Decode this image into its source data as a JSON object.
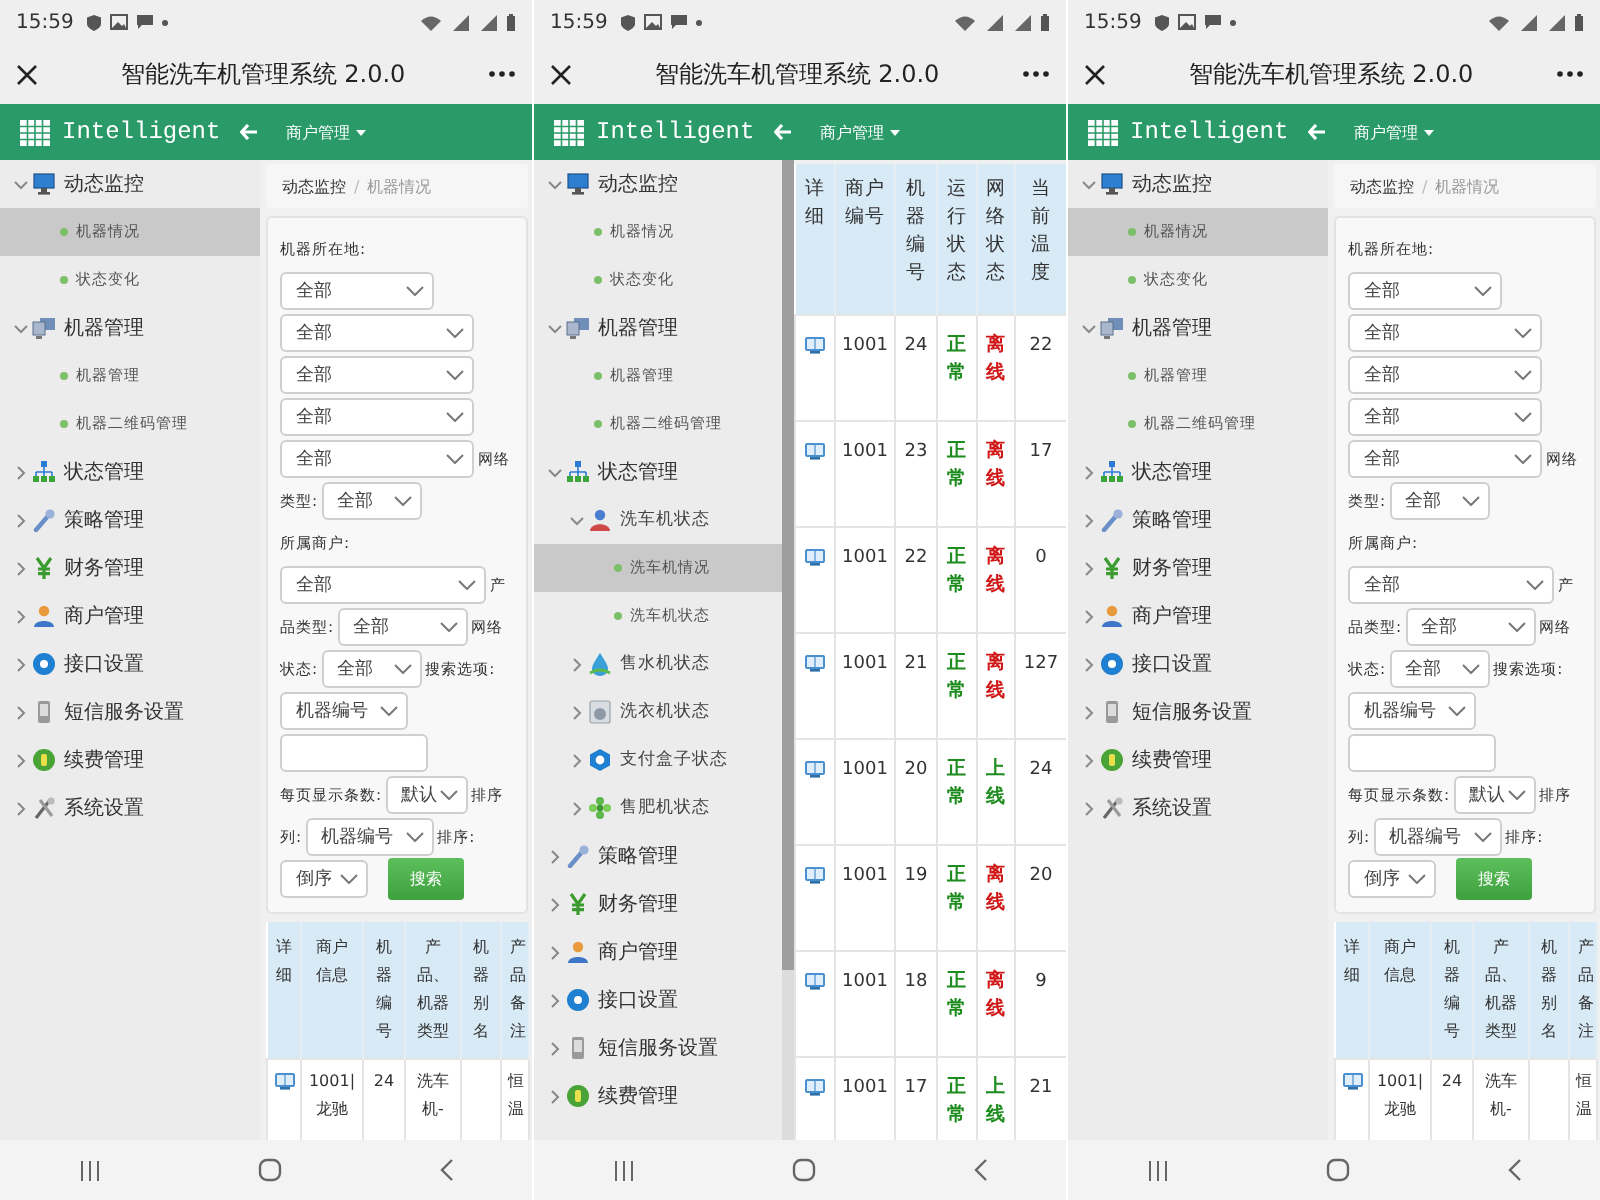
{
  "screens": [
    {
      "status_bar": {
        "time": "15:59"
      },
      "title_bar": {
        "title": "智能洗车机管理系统 2.0.0"
      },
      "header": {
        "brand": "Intelligent",
        "menu": "商户管理"
      },
      "sidebar": {
        "items": [
          {
            "label": "动态监控",
            "expanded": true,
            "selected": false,
            "children": [
              {
                "label": "机器情况",
                "selected": true
              },
              {
                "label": "状态变化",
                "selected": false
              }
            ]
          },
          {
            "label": "机器管理",
            "expanded": true,
            "selected": false,
            "children": [
              {
                "label": "机器管理",
                "selected": false
              },
              {
                "label": "机器二维码管理",
                "selected": false
              }
            ]
          },
          {
            "label": "状态管理",
            "expanded": false,
            "selected": false
          },
          {
            "label": "策略管理",
            "expanded": false,
            "selected": false
          },
          {
            "label": "财务管理",
            "expanded": false,
            "selected": false
          },
          {
            "label": "商户管理",
            "expanded": false,
            "selected": false
          },
          {
            "label": "接口设置",
            "expanded": false,
            "selected": false
          },
          {
            "label": "短信服务设置",
            "expanded": false,
            "selected": false
          },
          {
            "label": "续费管理",
            "expanded": false,
            "selected": false
          },
          {
            "label": "系统设置",
            "expanded": false,
            "selected": false
          }
        ]
      },
      "content": {
        "kind": "form",
        "breadcrumb": {
          "items": [
            "动态监控",
            "机器情况"
          ],
          "separator": "/"
        },
        "form": {
          "lines": [
            [
              {
                "kind": "label",
                "text": "机器所在地:"
              }
            ],
            [
              {
                "kind": "select",
                "value": "全部"
              }
            ],
            [
              {
                "kind": "select",
                "value": "全部"
              }
            ],
            [
              {
                "kind": "select",
                "value": "全部"
              }
            ],
            [
              {
                "kind": "select",
                "value": "全部"
              }
            ],
            [
              {
                "kind": "select",
                "value": "全部"
              },
              {
                "kind": "label",
                "text": "网络"
              }
            ],
            [
              {
                "kind": "label",
                "text": "类型:"
              },
              {
                "kind": "select",
                "value": "全部"
              }
            ],
            [
              {
                "kind": "label",
                "text": "所属商户:"
              }
            ],
            [
              {
                "kind": "select",
                "value": "全部"
              },
              {
                "kind": "label",
                "text": "产"
              }
            ],
            [
              {
                "kind": "label",
                "text": "品类型:"
              },
              {
                "kind": "select",
                "value": "全部"
              },
              {
                "kind": "label",
                "text": "网络"
              }
            ],
            [
              {
                "kind": "label",
                "text": "状态:"
              },
              {
                "kind": "select",
                "value": "全部"
              },
              {
                "kind": "label",
                "text": "搜索选项:"
              }
            ],
            [
              {
                "kind": "select",
                "value": "机器编号"
              }
            ],
            [
              {
                "kind": "input"
              }
            ],
            [
              {
                "kind": "label",
                "text": "每页显示条数:"
              },
              {
                "kind": "select",
                "value": "默认"
              },
              {
                "kind": "label",
                "text": "排序"
              }
            ],
            [
              {
                "kind": "label",
                "text": "列:"
              },
              {
                "kind": "select",
                "value": "机器编号"
              },
              {
                "kind": "label",
                "text": "排序:"
              }
            ],
            [
              {
                "kind": "select",
                "value": "倒序"
              },
              {
                "kind": "button",
                "text": "搜索"
              }
            ]
          ]
        },
        "table": {
          "columns": [
            "详细",
            "商户信息",
            "机器编号",
            "产品、机器类型",
            "机器别名",
            "产品备注"
          ],
          "rows": [
            {
              "cells": [
                "",
                "1001|龙驰",
                "24",
                "洗车机-",
                "",
                "恒温"
              ]
            }
          ]
        }
      }
    },
    {
      "status_bar": {
        "time": "15:59"
      },
      "title_bar": {
        "title": "智能洗车机管理系统 2.0.0"
      },
      "header": {
        "brand": "Intelligent",
        "menu": "商户管理"
      },
      "sidebar": {
        "items": [
          {
            "label": "动态监控",
            "expanded": true,
            "selected": false,
            "children": [
              {
                "label": "机器情况",
                "selected": false
              },
              {
                "label": "状态变化",
                "selected": false
              }
            ]
          },
          {
            "label": "机器管理",
            "expanded": true,
            "selected": false,
            "children": [
              {
                "label": "机器管理",
                "selected": false
              },
              {
                "label": "机器二维码管理",
                "selected": false
              }
            ]
          },
          {
            "label": "状态管理",
            "expanded": true,
            "selected": false,
            "children": [
              {
                "label": "洗车机状态",
                "expanded": true,
                "selected": false,
                "children": [
                  {
                    "label": "洗车机情况",
                    "selected": true
                  },
                  {
                    "label": "洗车机状态",
                    "selected": false
                  }
                ]
              },
              {
                "label": "售水机状态",
                "expanded": false,
                "selected": false
              },
              {
                "label": "洗衣机状态",
                "expanded": false,
                "selected": false
              },
              {
                "label": "支付盒子状态",
                "expanded": false,
                "selected": false
              },
              {
                "label": "售肥机状态",
                "expanded": false,
                "selected": false
              }
            ]
          },
          {
            "label": "策略管理",
            "expanded": false,
            "selected": false
          },
          {
            "label": "财务管理",
            "expanded": false,
            "selected": false
          },
          {
            "label": "商户管理",
            "expanded": false,
            "selected": false
          },
          {
            "label": "接口设置",
            "expanded": false,
            "selected": false
          },
          {
            "label": "短信服务设置",
            "expanded": false,
            "selected": false
          },
          {
            "label": "续费管理",
            "expanded": false,
            "selected": false
          }
        ]
      },
      "content": {
        "kind": "table",
        "table": {
          "columns": [
            "详细",
            "商户编号",
            "机器编号",
            "运行状态",
            "网络状态",
            "当前温度"
          ],
          "rows": [
            {
              "cells": [
                "",
                "1001",
                "24",
                {
                  "text": "正常",
                  "color": "#1e8c1e"
                },
                {
                  "text": "离线",
                  "color": "#d01818"
                },
                "22"
              ]
            },
            {
              "cells": [
                "",
                "1001",
                "23",
                {
                  "text": "正常",
                  "color": "#1e8c1e"
                },
                {
                  "text": "离线",
                  "color": "#d01818"
                },
                "17"
              ]
            },
            {
              "cells": [
                "",
                "1001",
                "22",
                {
                  "text": "正常",
                  "color": "#1e8c1e"
                },
                {
                  "text": "离线",
                  "color": "#d01818"
                },
                "0"
              ]
            },
            {
              "cells": [
                "",
                "1001",
                "21",
                {
                  "text": "正常",
                  "color": "#1e8c1e"
                },
                {
                  "text": "离线",
                  "color": "#d01818"
                },
                "127"
              ]
            },
            {
              "cells": [
                "",
                "1001",
                "20",
                {
                  "text": "正常",
                  "color": "#1e8c1e"
                },
                {
                  "text": "上线",
                  "color": "#1e8c1e"
                },
                "24"
              ]
            },
            {
              "cells": [
                "",
                "1001",
                "19",
                {
                  "text": "正常",
                  "color": "#1e8c1e"
                },
                {
                  "text": "离线",
                  "color": "#d01818"
                },
                "20"
              ]
            },
            {
              "cells": [
                "",
                "1001",
                "18",
                {
                  "text": "正常",
                  "color": "#1e8c1e"
                },
                {
                  "text": "离线",
                  "color": "#d01818"
                },
                "9"
              ]
            },
            {
              "cells": [
                "",
                "1001",
                "17",
                {
                  "text": "正常",
                  "color": "#1e8c1e"
                },
                {
                  "text": "上线",
                  "color": "#1e8c1e"
                },
                "21"
              ]
            }
          ]
        }
      }
    },
    {
      "status_bar": {
        "time": "15:59"
      },
      "title_bar": {
        "title": "智能洗车机管理系统 2.0.0"
      },
      "header": {
        "brand": "Intelligent",
        "menu": "商户管理"
      },
      "sidebar": {
        "items": [
          {
            "label": "动态监控",
            "expanded": true,
            "selected": false,
            "children": [
              {
                "label": "机器情况",
                "selected": true
              },
              {
                "label": "状态变化",
                "selected": false
              }
            ]
          },
          {
            "label": "机器管理",
            "expanded": true,
            "selected": false,
            "children": [
              {
                "label": "机器管理",
                "selected": false
              },
              {
                "label": "机器二维码管理",
                "selected": false
              }
            ]
          },
          {
            "label": "状态管理",
            "expanded": false,
            "selected": false
          },
          {
            "label": "策略管理",
            "expanded": false,
            "selected": false
          },
          {
            "label": "财务管理",
            "expanded": false,
            "selected": false
          },
          {
            "label": "商户管理",
            "expanded": false,
            "selected": false
          },
          {
            "label": "接口设置",
            "expanded": false,
            "selected": false
          },
          {
            "label": "短信服务设置",
            "expanded": false,
            "selected": false
          },
          {
            "label": "续费管理",
            "expanded": false,
            "selected": false
          },
          {
            "label": "系统设置",
            "expanded": false,
            "selected": false
          }
        ]
      },
      "content": {
        "kind": "form",
        "breadcrumb": {
          "items": [
            "动态监控",
            "机器情况"
          ],
          "separator": "/"
        },
        "form": {
          "lines": [
            [
              {
                "kind": "label",
                "text": "机器所在地:"
              }
            ],
            [
              {
                "kind": "select",
                "value": "全部"
              }
            ],
            [
              {
                "kind": "select",
                "value": "全部"
              }
            ],
            [
              {
                "kind": "select",
                "value": "全部"
              }
            ],
            [
              {
                "kind": "select",
                "value": "全部"
              }
            ],
            [
              {
                "kind": "select",
                "value": "全部"
              },
              {
                "kind": "label",
                "text": "网络"
              }
            ],
            [
              {
                "kind": "label",
                "text": "类型:"
              },
              {
                "kind": "select",
                "value": "全部"
              }
            ],
            [
              {
                "kind": "label",
                "text": "所属商户:"
              }
            ],
            [
              {
                "kind": "select",
                "value": "全部"
              },
              {
                "kind": "label",
                "text": "产"
              }
            ],
            [
              {
                "kind": "label",
                "text": "品类型:"
              },
              {
                "kind": "select",
                "value": "全部"
              },
              {
                "kind": "label",
                "text": "网络"
              }
            ],
            [
              {
                "kind": "label",
                "text": "状态:"
              },
              {
                "kind": "select",
                "value": "全部"
              },
              {
                "kind": "label",
                "text": "搜索选项:"
              }
            ],
            [
              {
                "kind": "select",
                "value": "机器编号"
              }
            ],
            [
              {
                "kind": "input"
              }
            ],
            [
              {
                "kind": "label",
                "text": "每页显示条数:"
              },
              {
                "kind": "select",
                "value": "默认"
              },
              {
                "kind": "label",
                "text": "排序"
              }
            ],
            [
              {
                "kind": "label",
                "text": "列:"
              },
              {
                "kind": "select",
                "value": "机器编号"
              },
              {
                "kind": "label",
                "text": "排序:"
              }
            ],
            [
              {
                "kind": "select",
                "value": "倒序"
              },
              {
                "kind": "button",
                "text": "搜索"
              }
            ]
          ]
        },
        "table": {
          "columns": [
            "详细",
            "商户信息",
            "机器编号",
            "产品、机器类型",
            "机器别名",
            "产品备注"
          ],
          "rows": [
            {
              "cells": [
                "",
                "1001|龙驰",
                "24",
                "洗车机-",
                "",
                "恒温"
              ]
            }
          ]
        }
      }
    }
  ]
}
